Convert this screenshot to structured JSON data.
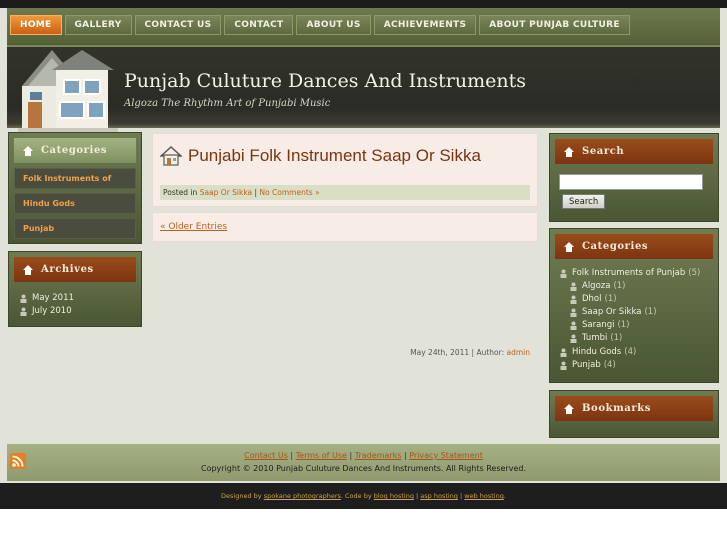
{
  "nav": [
    "HOME",
    "GALLERY",
    "CONTACT US",
    "CONTACT",
    "ABOUT US",
    "ACHIEVEMENTS",
    "ABOUT PUNJAB CULTURE"
  ],
  "site": {
    "title": "Punjab Culuture Dances And Instruments",
    "tagline": "Algoza The Rhythm Art of Punjabi Music"
  },
  "left_sidebar": {
    "categories_title": "Categories",
    "categories": [
      "Folk Instruments of",
      "Hindu Gods",
      "Punjab"
    ],
    "archives_title": "Archives",
    "archives": [
      "May 2011",
      "July 2010"
    ]
  },
  "post": {
    "title": "Punjabi Folk Instrument Saap Or Sikka",
    "date": "May 24th, 2011",
    "author_label": "| Author:",
    "author": "admin",
    "posted_in_label": "Posted in",
    "category": "Saap Or Sikka",
    "separator": "|",
    "comments": "No Comments »"
  },
  "older_entries": "« Older Entries",
  "right_sidebar": {
    "search_title": "Search",
    "search_value": "",
    "search_button": "Search",
    "categories_title": "Categories",
    "categories": [
      {
        "label": "Folk Instruments of Punjab",
        "count": "(5)",
        "level": 0
      },
      {
        "label": "Algoza",
        "count": "(1)",
        "level": 1
      },
      {
        "label": "Dhol",
        "count": "(1)",
        "level": 1
      },
      {
        "label": "Saap Or Sikka",
        "count": "(1)",
        "level": 1
      },
      {
        "label": "Sarangi",
        "count": "(1)",
        "level": 1
      },
      {
        "label": "Tumbi",
        "count": "(1)",
        "level": 1
      },
      {
        "label": "Hindu Gods",
        "count": "(4)",
        "level": 0
      },
      {
        "label": "Punjab",
        "count": "(4)",
        "level": 0
      }
    ],
    "bookmarks_title": "Bookmarks"
  },
  "footer": {
    "links": [
      "Contact Us",
      "Terms of Use",
      "Trademarks",
      "Privacy Statement"
    ],
    "copyright": "Copyright © 2010 Punjab Culuture Dances And Instruments. All Rights Reserved."
  },
  "credits": {
    "designed_by_label": "Designed by",
    "designer": "spokane photographers",
    "code_by_label": ". Code by",
    "links": [
      "blog hosting",
      "asp hosting",
      "web hosting"
    ]
  },
  "colors": {
    "accent_orange": "#e8832f",
    "header_olive": "#5d6a40",
    "widget_head_rust": "#8b3e14",
    "link_orange": "#c0601e"
  }
}
